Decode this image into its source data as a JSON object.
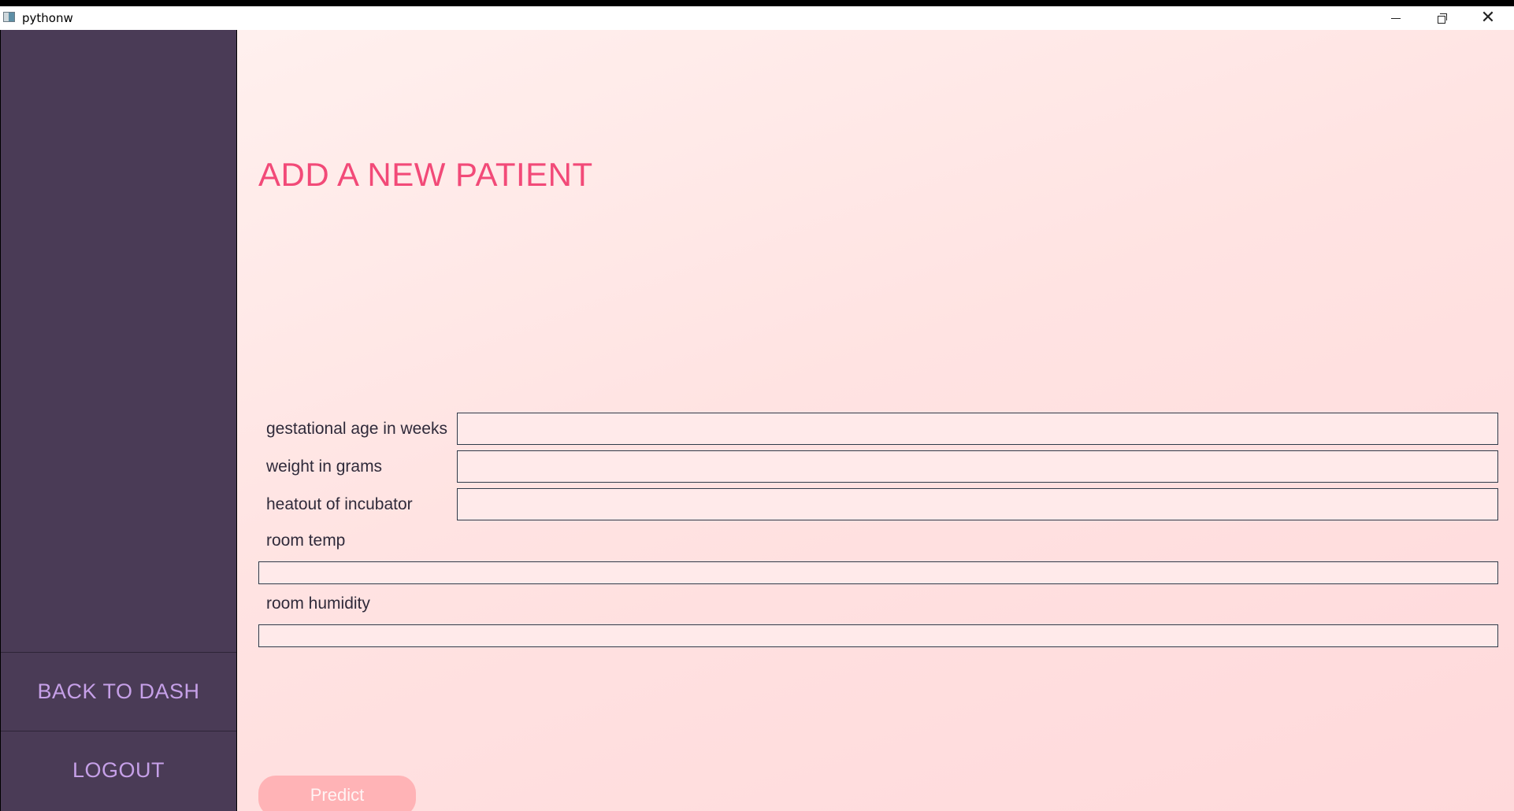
{
  "window": {
    "title": "pythonw",
    "controls": {
      "minimize_icon": "minimize-icon",
      "maximize_icon": "restore-icon",
      "close_icon": "close-icon",
      "close_glyph": "✕"
    }
  },
  "sidebar": {
    "back_label": "BACK TO DASH",
    "logout_label": "LOGOUT"
  },
  "main": {
    "title": "ADD A NEW PATIENT",
    "fields": [
      {
        "label": "gestational age in weeks",
        "value": ""
      },
      {
        "label": "weight in grams",
        "value": ""
      },
      {
        "label": "heatout of incubator",
        "value": ""
      },
      {
        "label": "room temp",
        "value": ""
      },
      {
        "label": "room humidity",
        "value": ""
      }
    ],
    "predict_label": "Predict"
  },
  "colors": {
    "sidebar_bg": "#4a3b56",
    "sidebar_text": "#c6a0e8",
    "title_color": "#f24a78",
    "predict_bg": "#ffb3b6",
    "main_bg": "#ffe3e2"
  }
}
